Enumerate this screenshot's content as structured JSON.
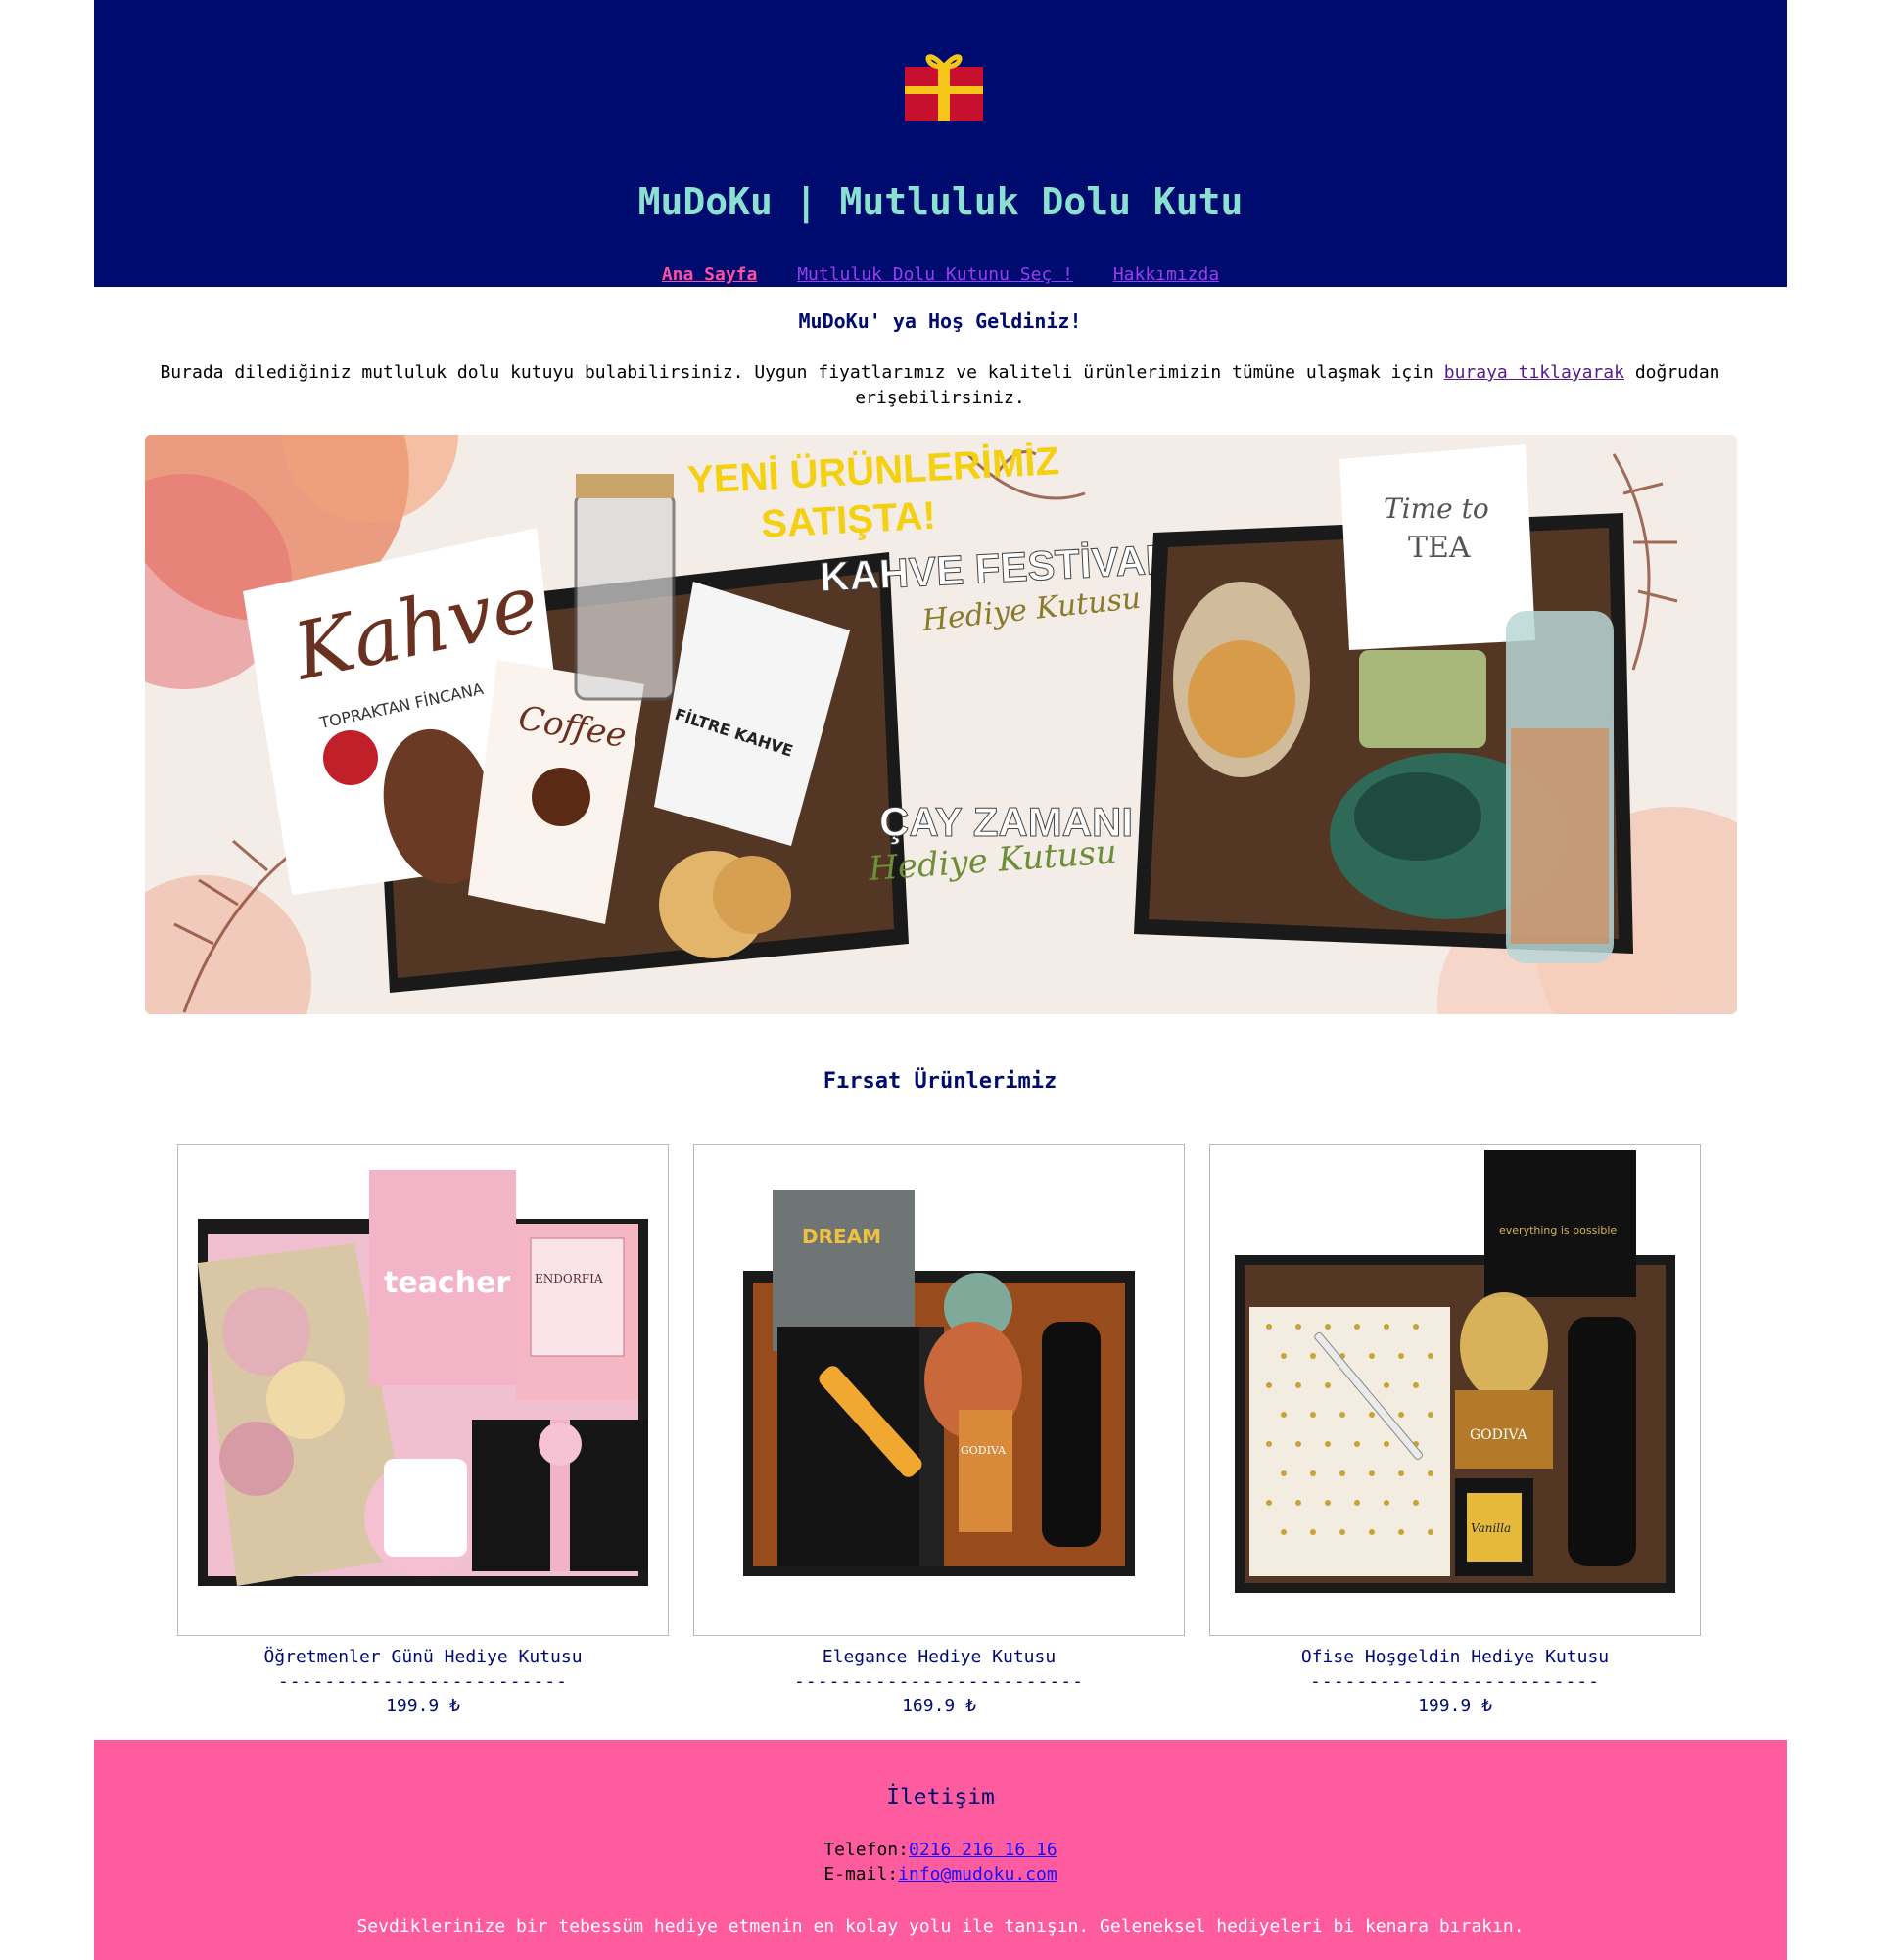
{
  "header": {
    "logo_icon": "gift-box-icon",
    "title": "MuDoKu | Mutluluk Dolu Kutu",
    "nav": {
      "home": "Ana Sayfa",
      "pick": "Mutluluk Dolu Kutunu Seç !",
      "about": "Hakkımızda"
    },
    "colors": {
      "background": "#000b6f",
      "title": "#8be1cf",
      "active_link": "#ff4fa0"
    }
  },
  "welcome": {
    "heading": "MuDoKu' ya Hoş Geldiniz!",
    "text_before": "Burada dilediğiniz mutluluk dolu kutuyu bulabilirsiniz. Uygun fiyatlarımız ve kaliteli ürünlerimizin tümüne ulaşmak için ",
    "link": "buraya tıklayarak",
    "text_after": " doğrudan erişebilirsiniz."
  },
  "banner": {
    "line1": "YENİ ÜRÜNLERİMİZ",
    "line2": "SATIŞTA!",
    "festival": "KAHVE FESTİVALİ",
    "festival_sub": "Hediye Kutusu",
    "tea": "ÇAY ZAMANI",
    "tea_sub": "Hediye Kutusu",
    "book_title": "Kahve",
    "book_sub": "TOPRAKTAN FİNCANA",
    "card": "Coffee",
    "filter": "FİLTRE KAHVE",
    "tea_card1": "Time to",
    "tea_card2": "TEA"
  },
  "deals": {
    "heading": "Fırsat Ürünlerimiz",
    "products": [
      {
        "name": "Öğretmenler Günü Hediye Kutusu",
        "separator": "-------------------------",
        "price": "199.9 ₺",
        "card_text": "teacher",
        "brand": "ENDORFIA"
      },
      {
        "name": "Elegance Hediye Kutusu",
        "separator": "-------------------------",
        "price": "169.9 ₺",
        "card_text": "DREAM",
        "brand": "GODIVA"
      },
      {
        "name": "Ofise Hoşgeldin Hediye Kutusu",
        "separator": "-------------------------",
        "price": "199.9 ₺",
        "card_text": "everything is possible",
        "brand": "GODIVA",
        "candle": "Vanilla"
      }
    ]
  },
  "footer": {
    "heading": "İletişim",
    "phone_label": "Telefon:",
    "phone": "0216 216 16 16",
    "email_label": "E-mail:",
    "email": "info@mudoku.com",
    "tagline": "Sevdiklerinize bir tebessüm hediye etmenin en kolay yolu ile tanışın. Geleneksel hediyeleri bi kenara bırakın.",
    "background": "#ff5ca0"
  }
}
